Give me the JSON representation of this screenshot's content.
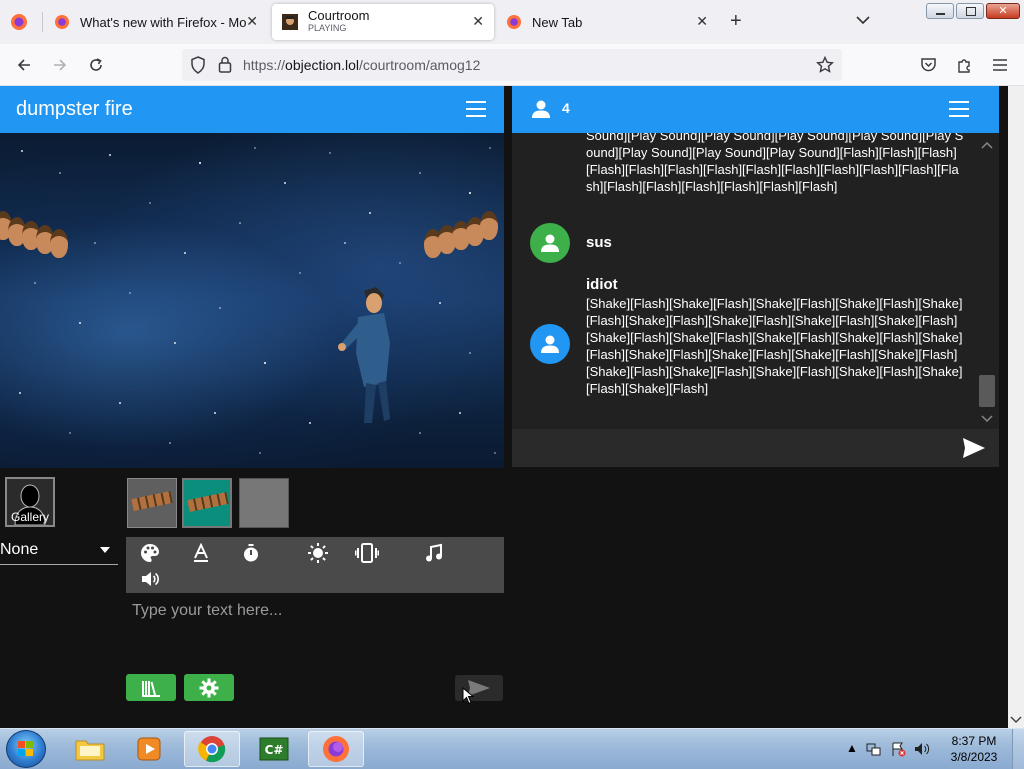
{
  "browser": {
    "tabs": [
      {
        "title": "What's new with Firefox - More"
      },
      {
        "title": "Courtroom",
        "subtitle": "PLAYING"
      },
      {
        "title": "New Tab"
      }
    ],
    "url_prefix": "https://",
    "url_host": "objection.lol",
    "url_path": "/courtroom/amog12"
  },
  "app": {
    "room_title": "dumpster fire",
    "gallery_label": "Gallery",
    "pose_select": "None",
    "text_placeholder": "Type your text here...",
    "user_count": "4"
  },
  "chat": {
    "messages": [
      {
        "name": "",
        "text": "Sound][Play Sound][Play Sound][Play Sound][Play Sound][Play Sound][Play Sound][Play Sound][Play Sound][Flash][Flash][Flash][Flash][Flash][Flash][Flash][Flash][Flash][Flash][Flash][Flash][Flash][Flash][Flash][Flash][Flash][Flash][Flash]"
      },
      {
        "name": "sus",
        "text": ""
      },
      {
        "name": "idiot",
        "text": "[Shake][Flash][Shake][Flash][Shake][Flash][Shake][Flash][Shake][Flash][Shake][Flash][Shake][Flash][Shake][Flash][Shake][Flash][Shake][Flash][Shake][Flash][Shake][Flash][Shake][Flash][Shake][Flash][Shake][Flash][Shake][Flash][Shake][Flash][Shake][Flash][Shake][Flash][Shake][Flash][Shake][Flash][Shake][Flash][Shake][Flash][Shake][Flash]"
      }
    ]
  },
  "taskbar": {
    "time": "8:37 PM",
    "date": "3/8/2023"
  },
  "colors": {
    "appbar": "#2196f3",
    "green_button": "#3db04a",
    "teal_selected": "#0b8f7c",
    "avatar_green": "#3db04a",
    "avatar_blue": "#2196f3"
  }
}
